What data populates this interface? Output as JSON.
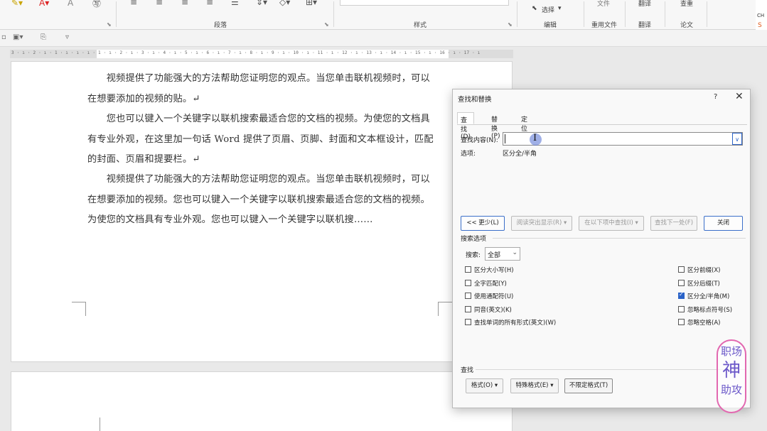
{
  "ribbon": {
    "groups": {
      "paragraph": "段落",
      "styles": "样式",
      "editing": "编辑",
      "reuse_files": "重用文件",
      "translate": "翻译",
      "paper": "论文"
    },
    "top_labels": {
      "file": "文件",
      "translate": "翻译",
      "check": "查重"
    },
    "select_label": "选择",
    "side_strip": "CH"
  },
  "ruler": {
    "text": "3 · ı · 2 · ı · 1 · ı · ı · ı · 1 · ı · 2 · ı · 3 · ı · 4 · ı · 5 · ı · 6 · ı · 7 · ı · 8 · ı · 9 · ı · 10 · ı · 11 · ı · 12 · ı · 13 · ı · 14 · ı · 15 · ı · 16 · ı · 17 · ı"
  },
  "document": {
    "paragraphs": [
      "　　视频提供了功能强大的方法帮助您证明您的观点。当您单击联机视频时，可以在想要添加的视频的贴。↵",
      "　　您也可以键入一个关键字以联机搜索最适合您的文档的视频。为使您的文档具有专业外观，在这里加一句话 Word 提供了页眉、页脚、封面和文本框设计，匹配的封面、页眉和提要栏。↵",
      "　　视频提供了功能强大的方法帮助您证明您的观点。当您单击联机视频时，可以在想要添加的视频。您也可以键入一个关键字以联机搜索最适合您的文档的视频。为使您的文档具有专业外观。您也可以键入一个关键字以联机搜……"
    ]
  },
  "dialog": {
    "title": "查找和替换",
    "help": "?",
    "close": "✕",
    "tabs": [
      {
        "label": "查找(D)"
      },
      {
        "label": "替换(P)"
      },
      {
        "label": "定位(G)"
      }
    ],
    "find_label": "查找内容(N):",
    "find_value": "",
    "options_label": "选项:",
    "options_value": "区分全/半角",
    "buttons": {
      "less": "<< 更少(L)",
      "reading_highlight": "阅读突出显示(R) ▾",
      "find_in": "在以下项中查找(I) ▾",
      "find_next": "查找下一处(F)",
      "close": "关闭"
    },
    "search_options_title": "搜索选项",
    "search_label": "搜索:",
    "search_value": "全部",
    "checkboxes_left": [
      {
        "label": "区分大小写(H)",
        "checked": false
      },
      {
        "label": "全字匹配(Y)",
        "checked": false
      },
      {
        "label": "使用通配符(U)",
        "checked": false
      },
      {
        "label": "同音(英文)(K)",
        "checked": false
      },
      {
        "label": "查找单词的所有形式(英文)(W)",
        "checked": false
      }
    ],
    "checkboxes_right": [
      {
        "label": "区分前缀(X)",
        "checked": false
      },
      {
        "label": "区分后缀(T)",
        "checked": false
      },
      {
        "label": "区分全/半角(M)",
        "checked": true
      },
      {
        "label": "忽略标点符号(S)",
        "checked": false
      },
      {
        "label": "忽略空格(A)",
        "checked": false
      }
    ],
    "find_section_title": "查找",
    "bottom_buttons": {
      "format": "格式(O) ▾",
      "special": "特殊格式(E) ▾",
      "no_format": "不限定格式(T)"
    }
  },
  "watermark": {
    "line1": "职场",
    "line2": "神",
    "line3": "助攻"
  }
}
